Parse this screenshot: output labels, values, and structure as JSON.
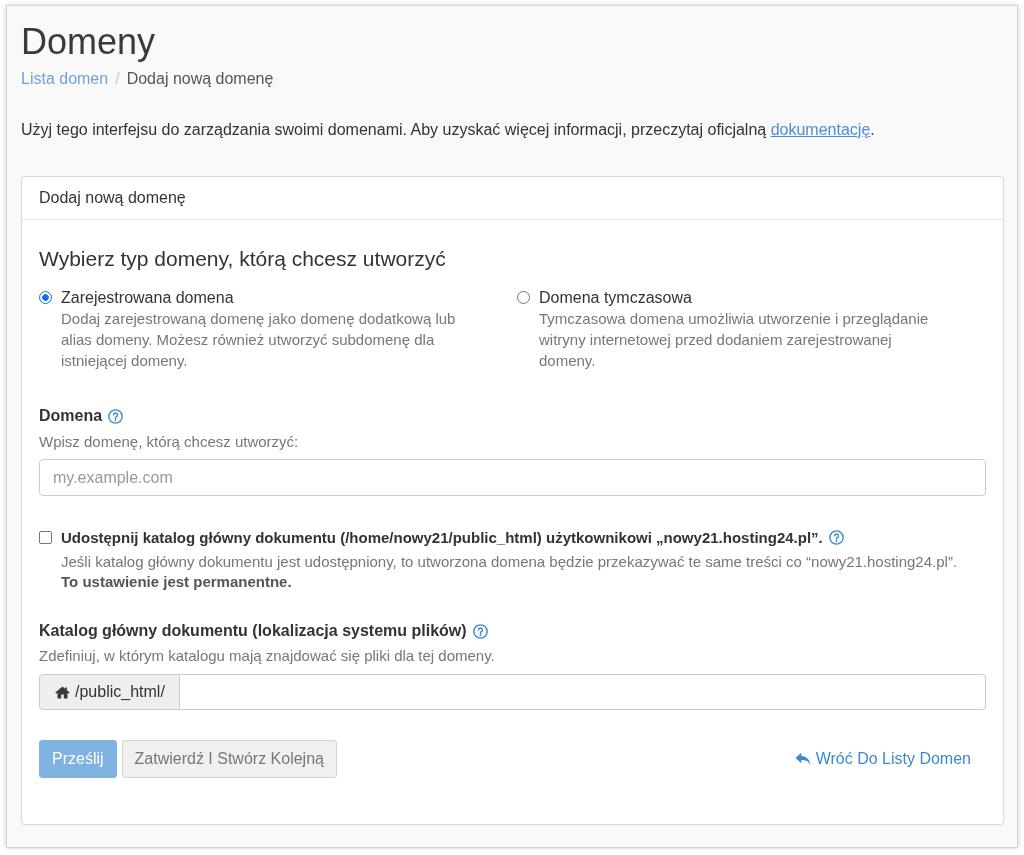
{
  "page": {
    "title": "Domeny"
  },
  "breadcrumb": {
    "separator": "/",
    "items": [
      {
        "label": "Lista domen",
        "kind": "link"
      },
      {
        "label": "Dodaj nową domenę",
        "kind": "current"
      }
    ]
  },
  "intro": {
    "text": "Użyj tego interfejsu do zarządzania swoimi domenami. Aby uzyskać więcej informacji, przeczytaj oficjalną",
    "link": "dokumentację",
    "end": "."
  },
  "card": {
    "header": "Dodaj nową domenę",
    "heading": "Wybierz typ domeny, którą chcesz utworzyć",
    "domain_types": [
      {
        "label": "Zarejestrowana domena",
        "description": "Dodaj zarejestrowaną domenę jako domenę dodatkową lub alias domeny. Możesz również utworzyć subdomenę dla istniejącej domeny.",
        "selected": true
      },
      {
        "label": "Domena tymczasowa",
        "description": "Tymczasowa domena umożliwia utworzenie i przeglądanie witryny internetowej przed dodaniem zarejestrowanej domeny.",
        "selected": false
      }
    ],
    "domain_field": {
      "label": "Domena",
      "hint": "Wpisz domenę, którą chcesz utworzyć:",
      "placeholder": "my.example.com"
    },
    "share_option": {
      "label": "Udostępnij katalog główny dokumentu (/home/nowy21/public_html) użytkownikowi „nowy21.hosting24.pl”.",
      "checked": false,
      "help": "Jeśli katalog główny dokumentu jest udostępniony, to utworzona domena będzie przekazywać te same treści co “nowy21.hosting24.pl”.",
      "note": "To ustawienie jest permanentne."
    },
    "document_root": {
      "label": "Katalog główny dokumentu (lokalizacja systemu plików)",
      "hint": "Zdefiniuj, w którym katalogu mają znajdować się pliki dla tej domeny.",
      "prefix": "/public_html/"
    },
    "actions": [
      {
        "label": "Prześlij",
        "kind": "primary",
        "disabled": true
      },
      {
        "label": "Zatwierdź I Stwórz Kolejną",
        "kind": "secondary",
        "disabled": true
      }
    ],
    "back_link": "Wróć Do Listy Domen"
  }
}
